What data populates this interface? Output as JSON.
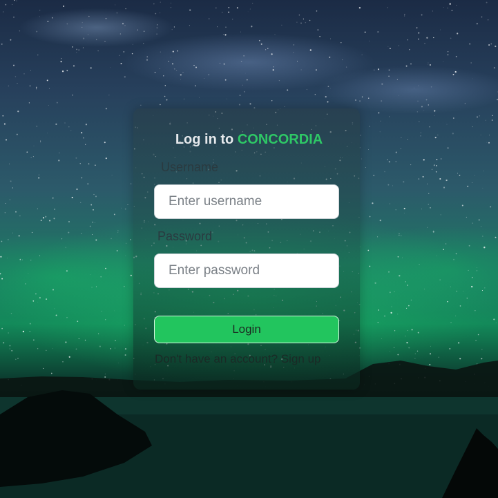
{
  "login": {
    "title_prefix": "Log in to",
    "brand": "CONCORDIA",
    "username_label": "Username",
    "username_placeholder": "Enter username",
    "username_value": "",
    "password_label": "Password",
    "password_placeholder": "Enter password",
    "password_value": "",
    "submit_label": "Login",
    "signup_prompt": "Don't have an account?",
    "signup_link": "Sign up"
  },
  "colors": {
    "brand": "#2ec866",
    "button": "#22c55e"
  }
}
